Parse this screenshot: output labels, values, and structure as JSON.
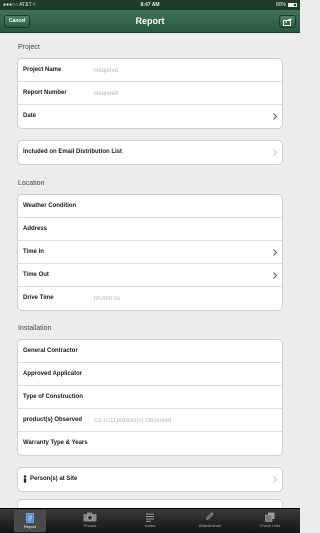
{
  "status_bar": {
    "carrier": "●●●○○ AT&T ≈",
    "time": "8:47 AM",
    "battery": "80%"
  },
  "nav": {
    "title": "Report",
    "cancel_label": "Cancel",
    "share_icon": "share-icon"
  },
  "sections": {
    "project": {
      "label": "Project",
      "rows": [
        {
          "label": "Project Name",
          "placeholder": "Required"
        },
        {
          "label": "Report Number",
          "placeholder": "Required"
        },
        {
          "label": "Date"
        }
      ]
    },
    "distribution": {
      "label": "Included on Email Distribution List"
    },
    "location": {
      "label": "Location",
      "rows": [
        {
          "label": "Weather Condition"
        },
        {
          "label": "Address"
        },
        {
          "label": "Time In"
        },
        {
          "label": "Time Out"
        },
        {
          "label": "Drive Time",
          "placeholder": "hh:mm:ss"
        }
      ]
    },
    "installation": {
      "label": "Installation",
      "rows": [
        {
          "label": "General Contractor"
        },
        {
          "label": "Approved Applicator"
        },
        {
          "label": "Type of Construction"
        },
        {
          "label": "product(s) Observed",
          "placeholder": "CETCO product(s) Observed"
        },
        {
          "label": "Warranty Type & Years"
        }
      ]
    },
    "persons": {
      "label": "Person(s) at Site"
    }
  },
  "tabs": [
    {
      "label": "Report",
      "icon": "report-icon",
      "active": true
    },
    {
      "label": "Photos",
      "icon": "camera-icon",
      "active": false
    },
    {
      "label": "Notes",
      "icon": "notes-icon",
      "active": false
    },
    {
      "label": "Attachments",
      "icon": "paperclip-icon",
      "active": false
    },
    {
      "label": "Check Lists",
      "icon": "checklist-icon",
      "active": false
    }
  ],
  "colors": {
    "nav_green": "#2f6047",
    "status_bar": "#1e3b2c",
    "background": "#ececec",
    "tab_bar": "#1e1e1e"
  }
}
